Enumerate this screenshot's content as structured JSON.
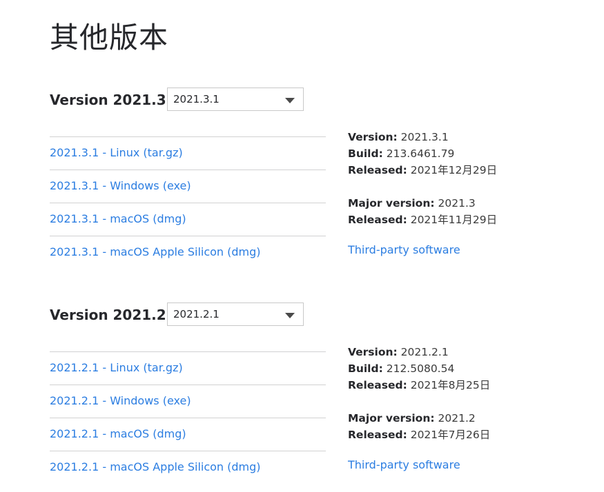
{
  "page": {
    "title": "其他版本"
  },
  "versions": [
    {
      "title": "Version 2021.3",
      "selected": "2021.3.1",
      "downloads": [
        "2021.3.1 - Linux (tar.gz)",
        "2021.3.1 - Windows (exe)",
        "2021.3.1 - macOS (dmg)",
        "2021.3.1 - macOS Apple Silicon (dmg)"
      ],
      "info": {
        "version_label": "Version:",
        "version_value": "2021.3.1",
        "build_label": "Build:",
        "build_value": "213.6461.79",
        "released_label": "Released:",
        "released_value": "2021年12月29日",
        "major_label": "Major version:",
        "major_value": "2021.3",
        "major_released_label": "Released:",
        "major_released_value": "2021年11月29日",
        "third_party": "Third-party software"
      }
    },
    {
      "title": "Version 2021.2",
      "selected": "2021.2.1",
      "downloads": [
        "2021.2.1 - Linux (tar.gz)",
        "2021.2.1 - Windows (exe)",
        "2021.2.1 - macOS (dmg)",
        "2021.2.1 - macOS Apple Silicon (dmg)"
      ],
      "info": {
        "version_label": "Version:",
        "version_value": "2021.2.1",
        "build_label": "Build:",
        "build_value": "212.5080.54",
        "released_label": "Released:",
        "released_value": "2021年8月25日",
        "major_label": "Major version:",
        "major_value": "2021.2",
        "major_released_label": "Released:",
        "major_released_value": "2021年7月26日",
        "third_party": "Third-party software"
      }
    }
  ],
  "colors": {
    "link": "#2b7de1",
    "text": "#27282c",
    "divider": "#d1d1d2"
  }
}
